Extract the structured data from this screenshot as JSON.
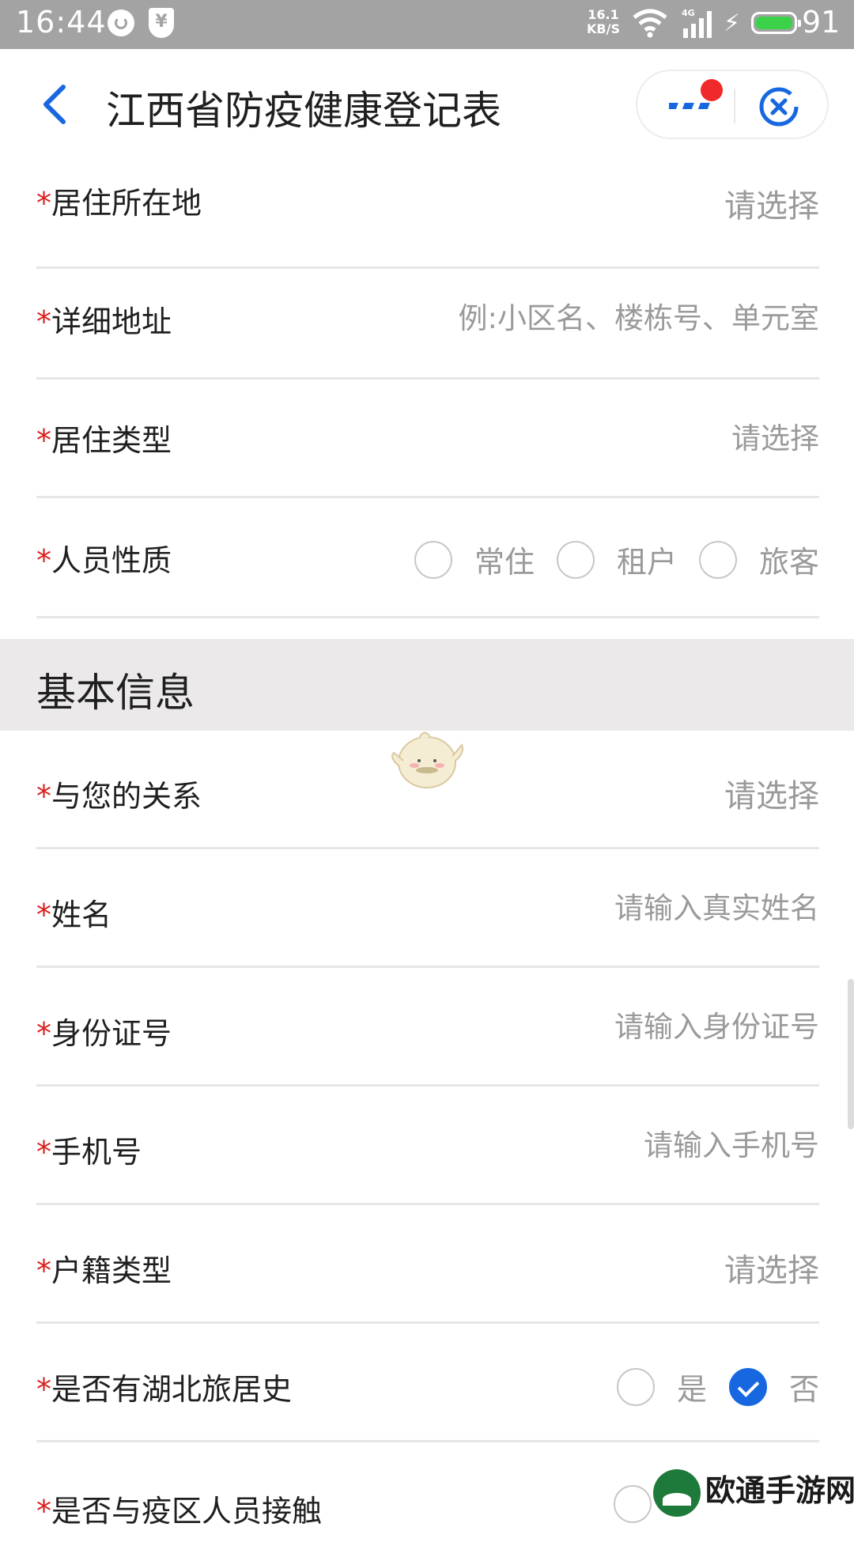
{
  "status_bar": {
    "time": "16:44",
    "net_speed_value": "16.1",
    "net_speed_unit": "KB/S",
    "network_type": "4G",
    "battery_level": "91",
    "battery_color": "#3bd24a"
  },
  "header": {
    "title": "江西省防疫健康登记表",
    "back_icon": "chevron-left-icon",
    "more_icon": "more-dots-icon",
    "close_icon": "close-circle-icon"
  },
  "residence_fields": [
    {
      "label": "居住所在地",
      "value": "请选择"
    },
    {
      "label": "详细地址",
      "placeholder": "例:小区名、楼栋号、单元室"
    },
    {
      "label": "居住类型",
      "value": "请选择"
    }
  ],
  "person_type": {
    "label": "人员性质",
    "options": [
      "常住",
      "租户",
      "旅客"
    ]
  },
  "section": {
    "title": "基本信息"
  },
  "basic_fields": [
    {
      "label": "与您的关系",
      "value": "请选择"
    },
    {
      "label": "姓名",
      "placeholder": "请输入真实姓名"
    },
    {
      "label": "身份证号",
      "placeholder": "请输入身份证号"
    },
    {
      "label": "手机号",
      "placeholder": "请输入手机号"
    },
    {
      "label": "户籍类型",
      "value": "请选择"
    }
  ],
  "hubei_history": {
    "label": "是否有湖北旅居史",
    "options": [
      "是",
      "否"
    ],
    "selected": "否"
  },
  "epidemic_contact": {
    "label": "是否与疫区人员接触"
  },
  "watermark": {
    "text": "欧通手游网"
  },
  "colors": {
    "accent": "#1768e0",
    "required": "#d9201f",
    "statusbar": "#a3a3a3"
  }
}
